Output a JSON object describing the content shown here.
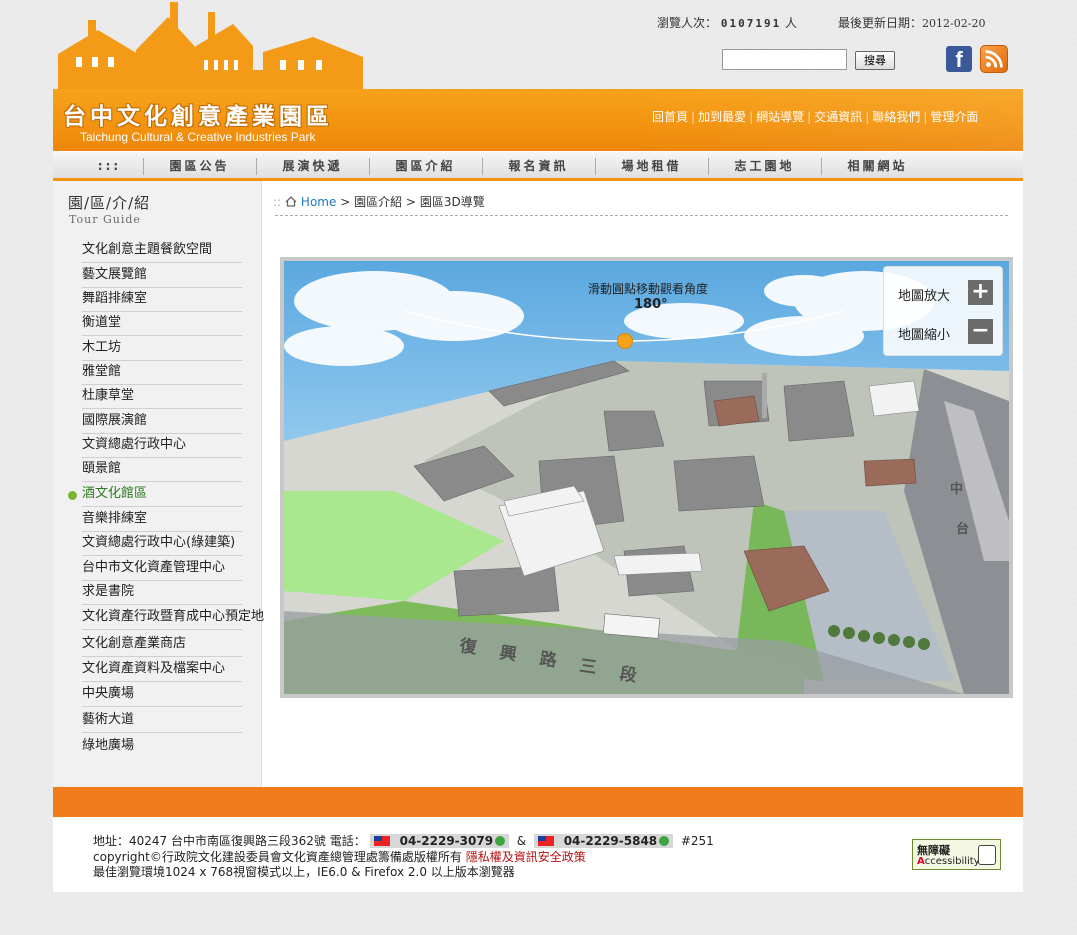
{
  "header": {
    "visitor_label": "瀏覽人次：",
    "visitor_count": "0107191",
    "visitor_unit": "人",
    "last_update_label": "最後更新日期：",
    "last_update_date": "2012-02-20",
    "search_button": "搜尋",
    "search_placeholder": "",
    "facebook_icon": "facebook-icon",
    "rss_icon": "rss-icon"
  },
  "banner": {
    "title": "台中文化創意產業園區",
    "subtitle": "Taichung Cultural & Creative Industries Park",
    "links": [
      "回首頁",
      "加到最愛",
      "網站導覽",
      "交通資訊",
      "聯絡我們",
      "管理介面"
    ]
  },
  "nav": {
    "leader": ":::",
    "items": [
      "園區公告",
      "展演快遞",
      "園區介紹",
      "報名資訊",
      "場地租借",
      "志工園地",
      "相關網站"
    ]
  },
  "sidebar": {
    "title": "園/區/介/紹",
    "subtitle": "Tour Guide",
    "active_index": 10,
    "items": [
      "文化創意主題餐飲空間",
      "藝文展覽館",
      "舞蹈排練室",
      "衡道堂",
      "木工坊",
      "雅堂館",
      "杜康草堂",
      "國際展演館",
      "文資總處行政中心",
      "頤景館",
      "酒文化館區",
      "音樂排練室",
      "文資總處行政中心(綠建築)",
      "台中市文化資產管理中心",
      "求是書院",
      "文化資產行政暨育成中心預定地",
      "文化創意產業商店",
      "文化資產資料及檔案中心",
      "中央廣場",
      "藝術大道",
      "綠地廣場"
    ]
  },
  "breadcrumb": {
    "home": "Home",
    "sep": ">",
    "level1": "園區介紹",
    "level2": "園區3D導覽"
  },
  "map": {
    "hint": "滑動圓點移動觀看角度",
    "angle": "180°",
    "zoom_in_label": "地圖放大",
    "zoom_out_label": "地圖縮小",
    "zoom_in_symbol": "+",
    "zoom_out_symbol": "−",
    "road_labels": [
      "復",
      "興",
      "路",
      "三",
      "段"
    ],
    "side_road_labels": [
      "台",
      "中"
    ]
  },
  "footer": {
    "address_label": "地址：",
    "address": "40247 台中市南區復興路三段362號",
    "phone_label": "電話：",
    "phone1": "04-2229-3079",
    "amp": "&",
    "phone2": "04-2229-5848",
    "ext": "#251",
    "copyright": "copyright©行政院文化建設委員會文化資產總管理處籌備處版權所有",
    "policy": "隱私權及資訊安全政策",
    "browser": "最佳瀏覽環境1024 x 768視窗模式以上，IE6.0 & Firefox 2.0 以上版本瀏覽器",
    "accessibility_line1": "無障礙",
    "accessibility_a": "A",
    "accessibility_line2": "ccessibility"
  },
  "colors": {
    "brand_orange": "#f39310",
    "footer_orange": "#ef7d1c",
    "active_green": "#2c7a1e",
    "link_blue": "#1a7bb8"
  }
}
